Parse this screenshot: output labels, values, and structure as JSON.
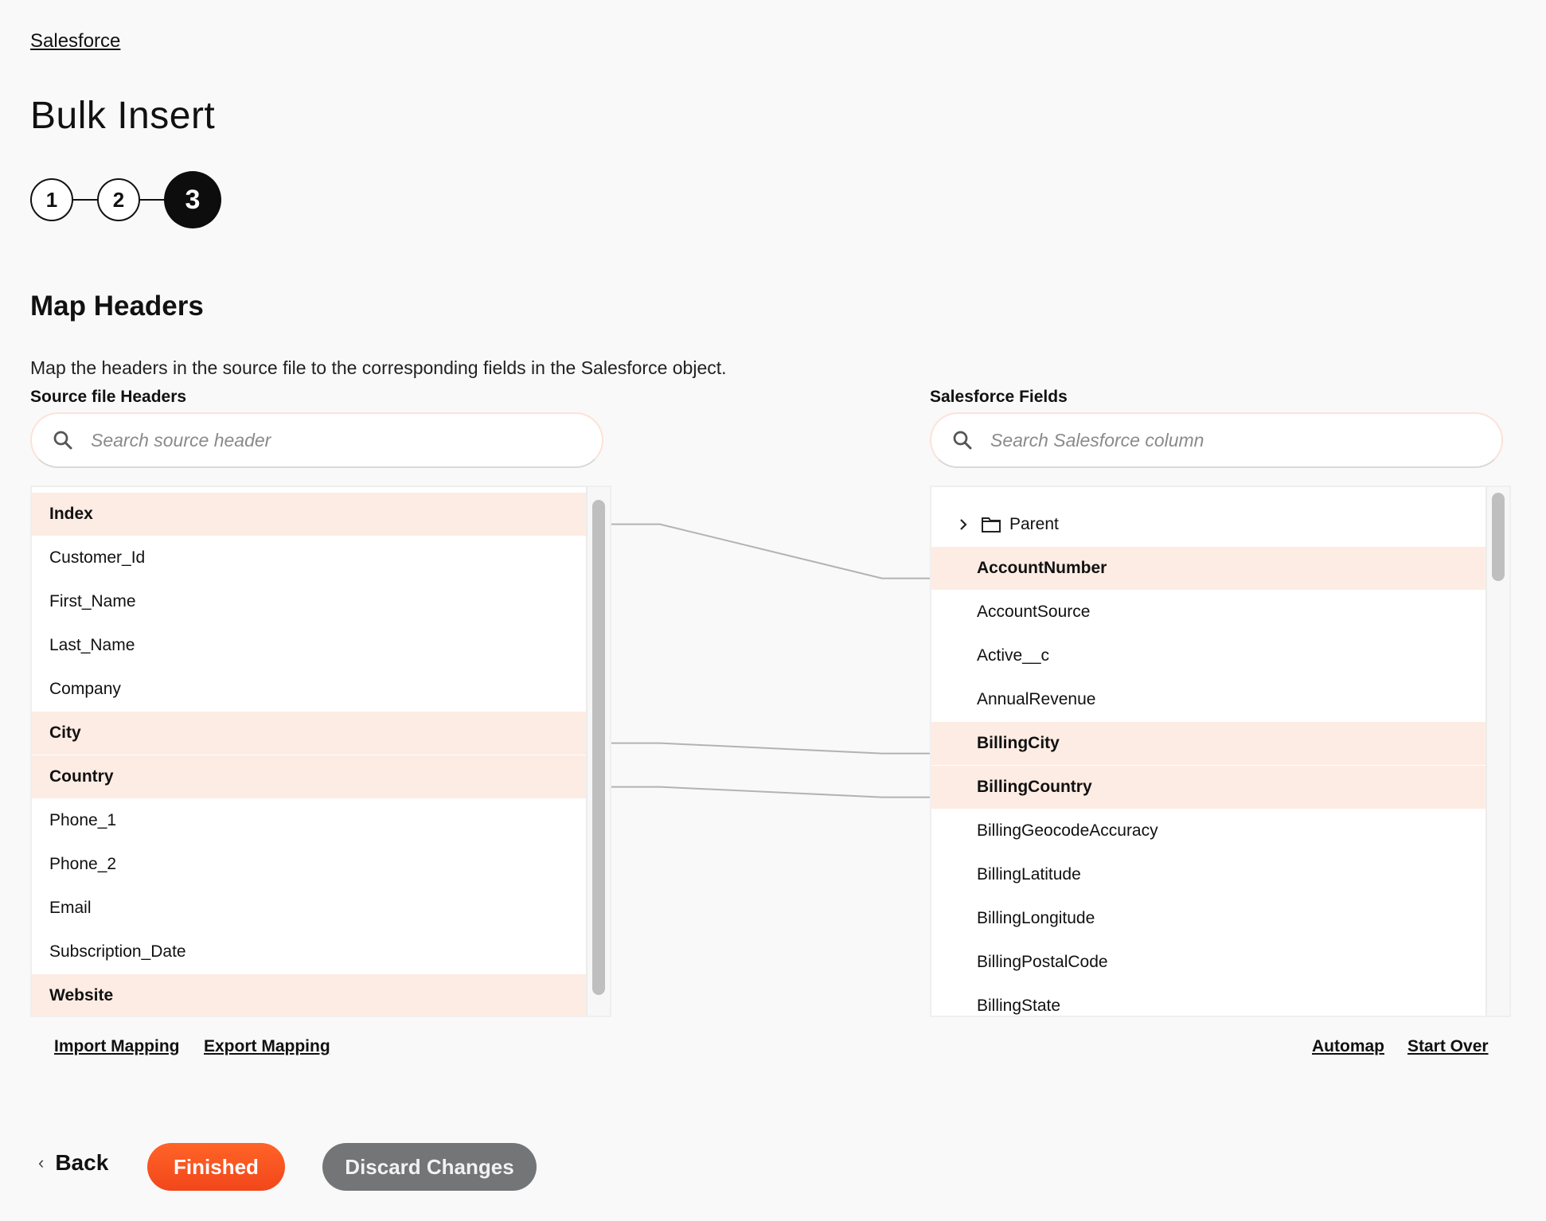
{
  "breadcrumb": {
    "label": "Salesforce"
  },
  "page": {
    "title": "Bulk Insert"
  },
  "stepper": {
    "steps": [
      {
        "label": "1",
        "state": "done"
      },
      {
        "label": "2",
        "state": "done"
      },
      {
        "label": "3",
        "state": "active"
      }
    ]
  },
  "section": {
    "title": "Map Headers",
    "description": "Map the headers in the source file to the corresponding fields in the Salesforce object."
  },
  "source": {
    "label": "Source file Headers",
    "search_placeholder": "Search source header",
    "search_icon": "search-icon",
    "items": [
      {
        "label": "Index",
        "mapped": true
      },
      {
        "label": "Customer_Id",
        "mapped": false
      },
      {
        "label": "First_Name",
        "mapped": false
      },
      {
        "label": "Last_Name",
        "mapped": false
      },
      {
        "label": "Company",
        "mapped": false
      },
      {
        "label": "City",
        "mapped": true
      },
      {
        "label": "Country",
        "mapped": true
      },
      {
        "label": "Phone_1",
        "mapped": false
      },
      {
        "label": "Phone_2",
        "mapped": false
      },
      {
        "label": "Email",
        "mapped": false
      },
      {
        "label": "Subscription_Date",
        "mapped": false
      },
      {
        "label": "Website",
        "mapped": true
      }
    ]
  },
  "target": {
    "label": "Salesforce Fields",
    "search_placeholder": "Search Salesforce column",
    "search_icon": "search-icon",
    "group": {
      "label": "Parent",
      "icon": "folder-icon",
      "expand_icon": "chevron-right-icon",
      "expanded": false
    },
    "items": [
      {
        "label": "AccountNumber",
        "mapped": true
      },
      {
        "label": "AccountSource",
        "mapped": false
      },
      {
        "label": "Active__c",
        "mapped": false
      },
      {
        "label": "AnnualRevenue",
        "mapped": false
      },
      {
        "label": "BillingCity",
        "mapped": true
      },
      {
        "label": "BillingCountry",
        "mapped": true
      },
      {
        "label": "BillingGeocodeAccuracy",
        "mapped": false
      },
      {
        "label": "BillingLatitude",
        "mapped": false
      },
      {
        "label": "BillingLongitude",
        "mapped": false
      },
      {
        "label": "BillingPostalCode",
        "mapped": false
      },
      {
        "label": "BillingState",
        "mapped": false
      }
    ]
  },
  "mappings": [
    {
      "source": "Index",
      "target": "AccountNumber"
    },
    {
      "source": "City",
      "target": "BillingCity"
    },
    {
      "source": "Country",
      "target": "BillingCountry"
    }
  ],
  "links": {
    "import": "Import Mapping",
    "export": "Export Mapping",
    "automap": "Automap",
    "start_over": "Start Over"
  },
  "footer": {
    "back": "Back",
    "finished": "Finished",
    "discard": "Discard Changes"
  },
  "colors": {
    "accent": "#f65a23",
    "mapped_row": "#fdece4",
    "discard": "#737576",
    "connector": "#b3b3b3"
  }
}
